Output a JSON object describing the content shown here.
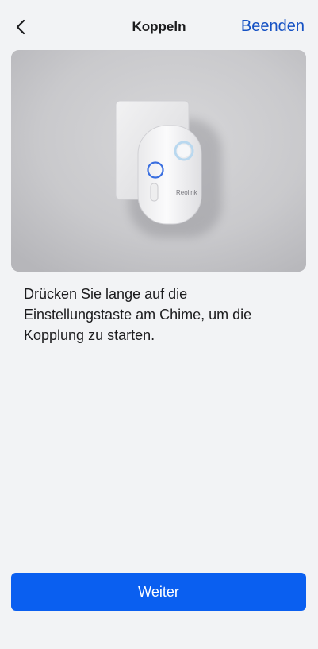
{
  "header": {
    "back_icon": "chevron-left-icon",
    "title": "Koppeln",
    "done_label": "Beenden"
  },
  "hero": {
    "device_brand": "Reolink",
    "highlight_color": "#3a6fe0"
  },
  "instruction": "Drücken Sie lange auf die Einstellungstaste am Chime, um die Kopplung zu starten.",
  "footer": {
    "next_label": "Weiter"
  },
  "colors": {
    "accent": "#1652c4",
    "primary_button": "#0a5ff0",
    "background": "#f2f3f5"
  }
}
